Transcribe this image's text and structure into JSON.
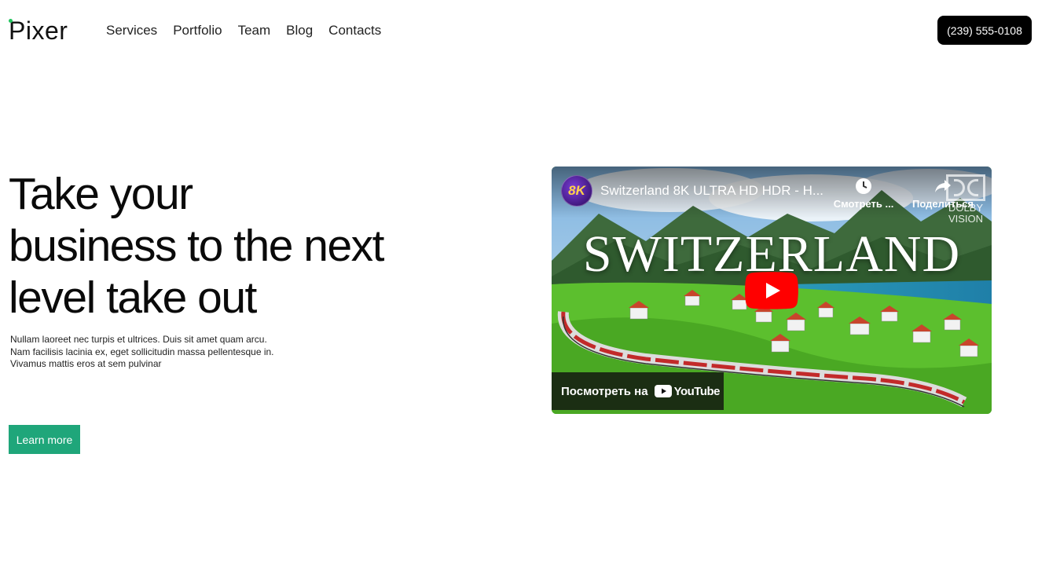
{
  "header": {
    "logo": "Pixer",
    "nav": [
      "Services",
      "Portfolio",
      "Team",
      "Blog",
      "Contacts"
    ],
    "phone": "(239) 555-0108"
  },
  "hero": {
    "title_lines": [
      "Take your",
      "business to the next",
      "level take out"
    ],
    "text_lines": [
      "Nullam laoreet nec turpis et ultrices. Duis sit amet quam arcu.",
      "Nam facilisis lacinia ex, eget sollicitudin massa pellentesque in.",
      "Vivamus mattis eros at sem pulvinar"
    ],
    "button": "Learn more"
  },
  "video": {
    "channel_badge": "8K",
    "title": "Switzerland 8K ULTRA HD HDR - H...",
    "watch_later": "Смотреть ...",
    "share": "Поделиться",
    "dolby_line1": "DOLBY",
    "dolby_line2": "VISION",
    "overlay_title": "SWITZERLAND",
    "watch_on": "Посмотреть на",
    "youtube": "YouTube"
  },
  "colors": {
    "accent_green": "#1fa67a",
    "logo_dot": "#22c55e",
    "phone_bg": "#000000",
    "youtube_red": "#ff0000"
  }
}
